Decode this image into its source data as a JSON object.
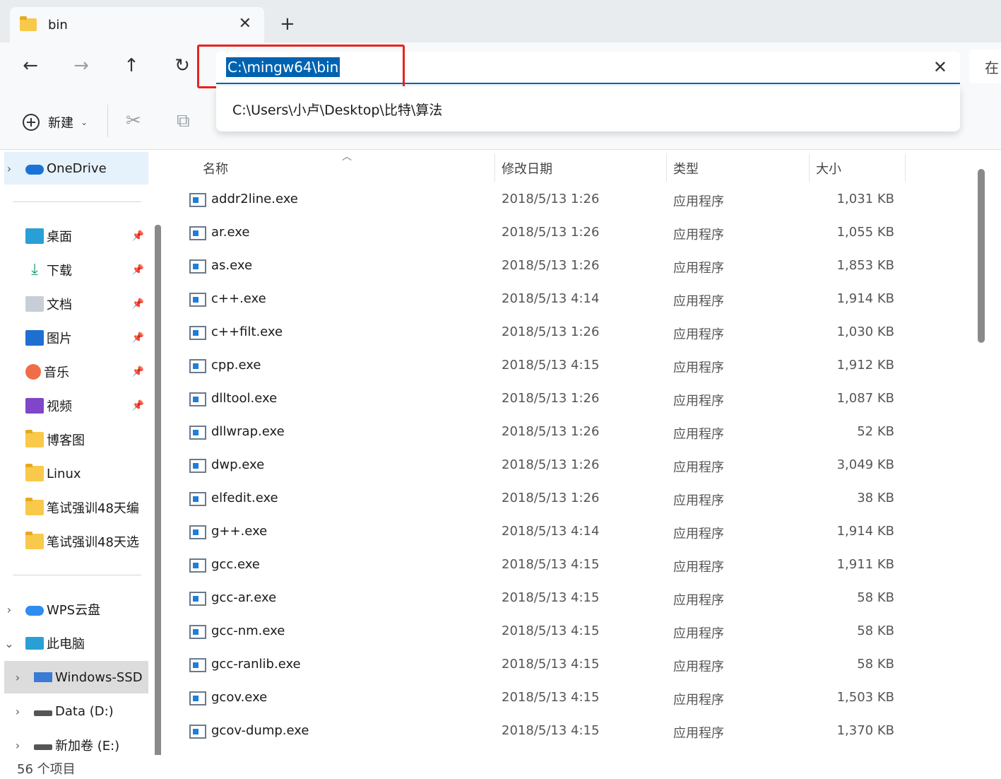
{
  "tab": {
    "title": "bin",
    "close": "✕",
    "new_tab": "+"
  },
  "nav": {
    "back": "←",
    "forward": "→",
    "up": "↑",
    "refresh": "↻"
  },
  "address": {
    "value": "C:\\mingw64\\bin",
    "clear": "✕",
    "suggestion": "C:\\Users\\小卢\\Desktop\\比特\\算法"
  },
  "search": {
    "stub": "在"
  },
  "command_bar": {
    "new_label": "新建",
    "caret": "⌄",
    "cut_icon": "✂",
    "copy_icon": "⧉"
  },
  "sidebar": {
    "onedrive": "OneDrive",
    "quick_access": [
      {
        "label": "桌面",
        "icon": "desktop-icon"
      },
      {
        "label": "下载",
        "icon": "download-icon"
      },
      {
        "label": "文档",
        "icon": "document-icon"
      },
      {
        "label": "图片",
        "icon": "pictures-icon"
      },
      {
        "label": "音乐",
        "icon": "music-icon"
      },
      {
        "label": "视频",
        "icon": "video-icon"
      },
      {
        "label": "博客图",
        "icon": "folder-icon"
      },
      {
        "label": "Linux",
        "icon": "folder-icon"
      },
      {
        "label": "笔试强训48天编",
        "icon": "folder-icon"
      },
      {
        "label": "笔试强训48天选",
        "icon": "folder-icon"
      }
    ],
    "wps": "WPS云盘",
    "this_pc": "此电脑",
    "drives": [
      {
        "label": "Windows-SSD"
      },
      {
        "label": "Data (D:)"
      },
      {
        "label": "新加卷 (E:)"
      }
    ]
  },
  "columns": {
    "name": "名称",
    "modified": "修改日期",
    "type": "类型",
    "size": "大小"
  },
  "files": [
    {
      "name": "addr2line.exe",
      "modified": "2018/5/13 1:26",
      "type": "应用程序",
      "size": "1,031 KB"
    },
    {
      "name": "ar.exe",
      "modified": "2018/5/13 1:26",
      "type": "应用程序",
      "size": "1,055 KB"
    },
    {
      "name": "as.exe",
      "modified": "2018/5/13 1:26",
      "type": "应用程序",
      "size": "1,853 KB"
    },
    {
      "name": "c++.exe",
      "modified": "2018/5/13 4:14",
      "type": "应用程序",
      "size": "1,914 KB"
    },
    {
      "name": "c++filt.exe",
      "modified": "2018/5/13 1:26",
      "type": "应用程序",
      "size": "1,030 KB"
    },
    {
      "name": "cpp.exe",
      "modified": "2018/5/13 4:15",
      "type": "应用程序",
      "size": "1,912 KB"
    },
    {
      "name": "dlltool.exe",
      "modified": "2018/5/13 1:26",
      "type": "应用程序",
      "size": "1,087 KB"
    },
    {
      "name": "dllwrap.exe",
      "modified": "2018/5/13 1:26",
      "type": "应用程序",
      "size": "52 KB"
    },
    {
      "name": "dwp.exe",
      "modified": "2018/5/13 1:26",
      "type": "应用程序",
      "size": "3,049 KB"
    },
    {
      "name": "elfedit.exe",
      "modified": "2018/5/13 1:26",
      "type": "应用程序",
      "size": "38 KB"
    },
    {
      "name": "g++.exe",
      "modified": "2018/5/13 4:14",
      "type": "应用程序",
      "size": "1,914 KB"
    },
    {
      "name": "gcc.exe",
      "modified": "2018/5/13 4:15",
      "type": "应用程序",
      "size": "1,911 KB"
    },
    {
      "name": "gcc-ar.exe",
      "modified": "2018/5/13 4:15",
      "type": "应用程序",
      "size": "58 KB"
    },
    {
      "name": "gcc-nm.exe",
      "modified": "2018/5/13 4:15",
      "type": "应用程序",
      "size": "58 KB"
    },
    {
      "name": "gcc-ranlib.exe",
      "modified": "2018/5/13 4:15",
      "type": "应用程序",
      "size": "58 KB"
    },
    {
      "name": "gcov.exe",
      "modified": "2018/5/13 4:15",
      "type": "应用程序",
      "size": "1,503 KB"
    },
    {
      "name": "gcov-dump.exe",
      "modified": "2018/5/13 4:15",
      "type": "应用程序",
      "size": "1,370 KB"
    }
  ],
  "status": {
    "count": "56 个项目"
  },
  "colors": {
    "accent": "#0063b1",
    "annotation": "#e8231e",
    "folder": "#f8c94a"
  }
}
